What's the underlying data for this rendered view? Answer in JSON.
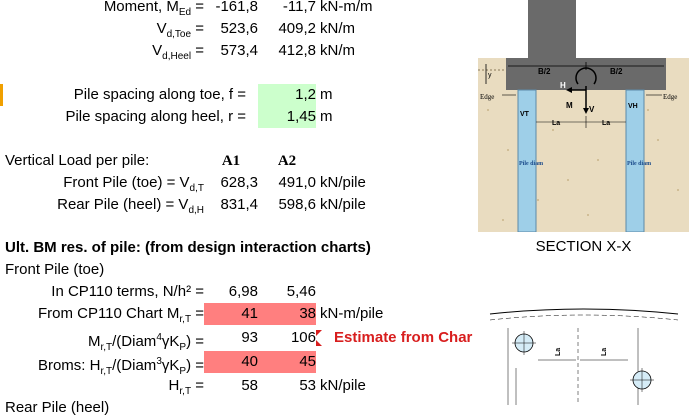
{
  "rows": {
    "moment": {
      "label": "Moment, M",
      "sub": "Ed",
      "suffix": " =",
      "v1": "-161,8",
      "v2": "-11,7",
      "unit": "kN-m/m"
    },
    "vdtoe": {
      "label": "V",
      "sub": "d,Toe",
      "suffix": " =",
      "v1": "523,6",
      "v2": "409,2",
      "unit": "kN/m"
    },
    "vdheel": {
      "label": "V",
      "sub": "d,Heel",
      "suffix": " =",
      "v1": "573,4",
      "v2": "412,8",
      "unit": "kN/m"
    },
    "spacing_toe": {
      "label": "Pile spacing along toe, f =",
      "value": "1,2",
      "unit": "m"
    },
    "spacing_heel": {
      "label": "Pile spacing along heel, r =",
      "value": "1,45",
      "unit": "m"
    },
    "vert_load": {
      "label": "Vertical Load per pile:",
      "a1": "A1",
      "a2": "A2"
    },
    "front_pile": {
      "label": "Front Pile (toe) = V",
      "sub": "d,T",
      "v1": "628,3",
      "v2": "491,0",
      "unit": "kN/pile"
    },
    "rear_pile": {
      "label": "Rear Pile (heel) = V",
      "sub": "d,H",
      "v1": "831,4",
      "v2": "598,6",
      "unit": "kN/pile"
    },
    "ult_header": "Ult. BM res. of pile: (from design interaction charts)",
    "front_pile_toe": "Front Pile (toe)",
    "cp110_terms": {
      "label": "In CP110 terms, N/h² =",
      "v1": "6,98",
      "v2": "5,46"
    },
    "cp110_chart": {
      "label": "From CP110 Chart  M",
      "sub": "r,T",
      "suffix": " =",
      "v1": "41",
      "v2": "38",
      "unit": "kN-m/pile"
    },
    "mr_ratio": {
      "label": "M",
      "sub": "r,T",
      "mid": "/(Diam",
      "sup": "4",
      "tail": "γK",
      "sub2": "P",
      "end": ") =",
      "v1": "93",
      "v2": "106"
    },
    "broms": {
      "label": "Broms:  H",
      "sub": "r,T",
      "mid": "/(Diam",
      "sup": "3",
      "tail": "γK",
      "sub2": "P",
      "end": ") =",
      "v1": "40",
      "v2": "45"
    },
    "hrt": {
      "label": "H",
      "sub": "r,T",
      "suffix": " =",
      "v1": "58",
      "v2": "53",
      "unit": "kN/pile"
    },
    "rear_pile_heel": "Rear Pile (heel)"
  },
  "note": "Estimate from Char",
  "section_caption": "SECTION X-X",
  "diagram": {
    "b2_left": "B/2",
    "b2_right": "B/2",
    "h": "H",
    "m": "M",
    "v": "V",
    "edge_left": "Edge",
    "edge_right": "Edge",
    "la_left": "La",
    "la_right": "La",
    "vt": "VT",
    "vh": "VH",
    "pile_diam": "Pile diam",
    "y": "y",
    "la_a": "La",
    "la_b": "La"
  },
  "colors": {
    "green_input": "#ccffcc",
    "red_result": "#ff7f7f",
    "note_red": "#d81e1e",
    "soil": "#e9dcc0",
    "concrete": "#6a6a6a",
    "pile": "#9ecfe8"
  }
}
